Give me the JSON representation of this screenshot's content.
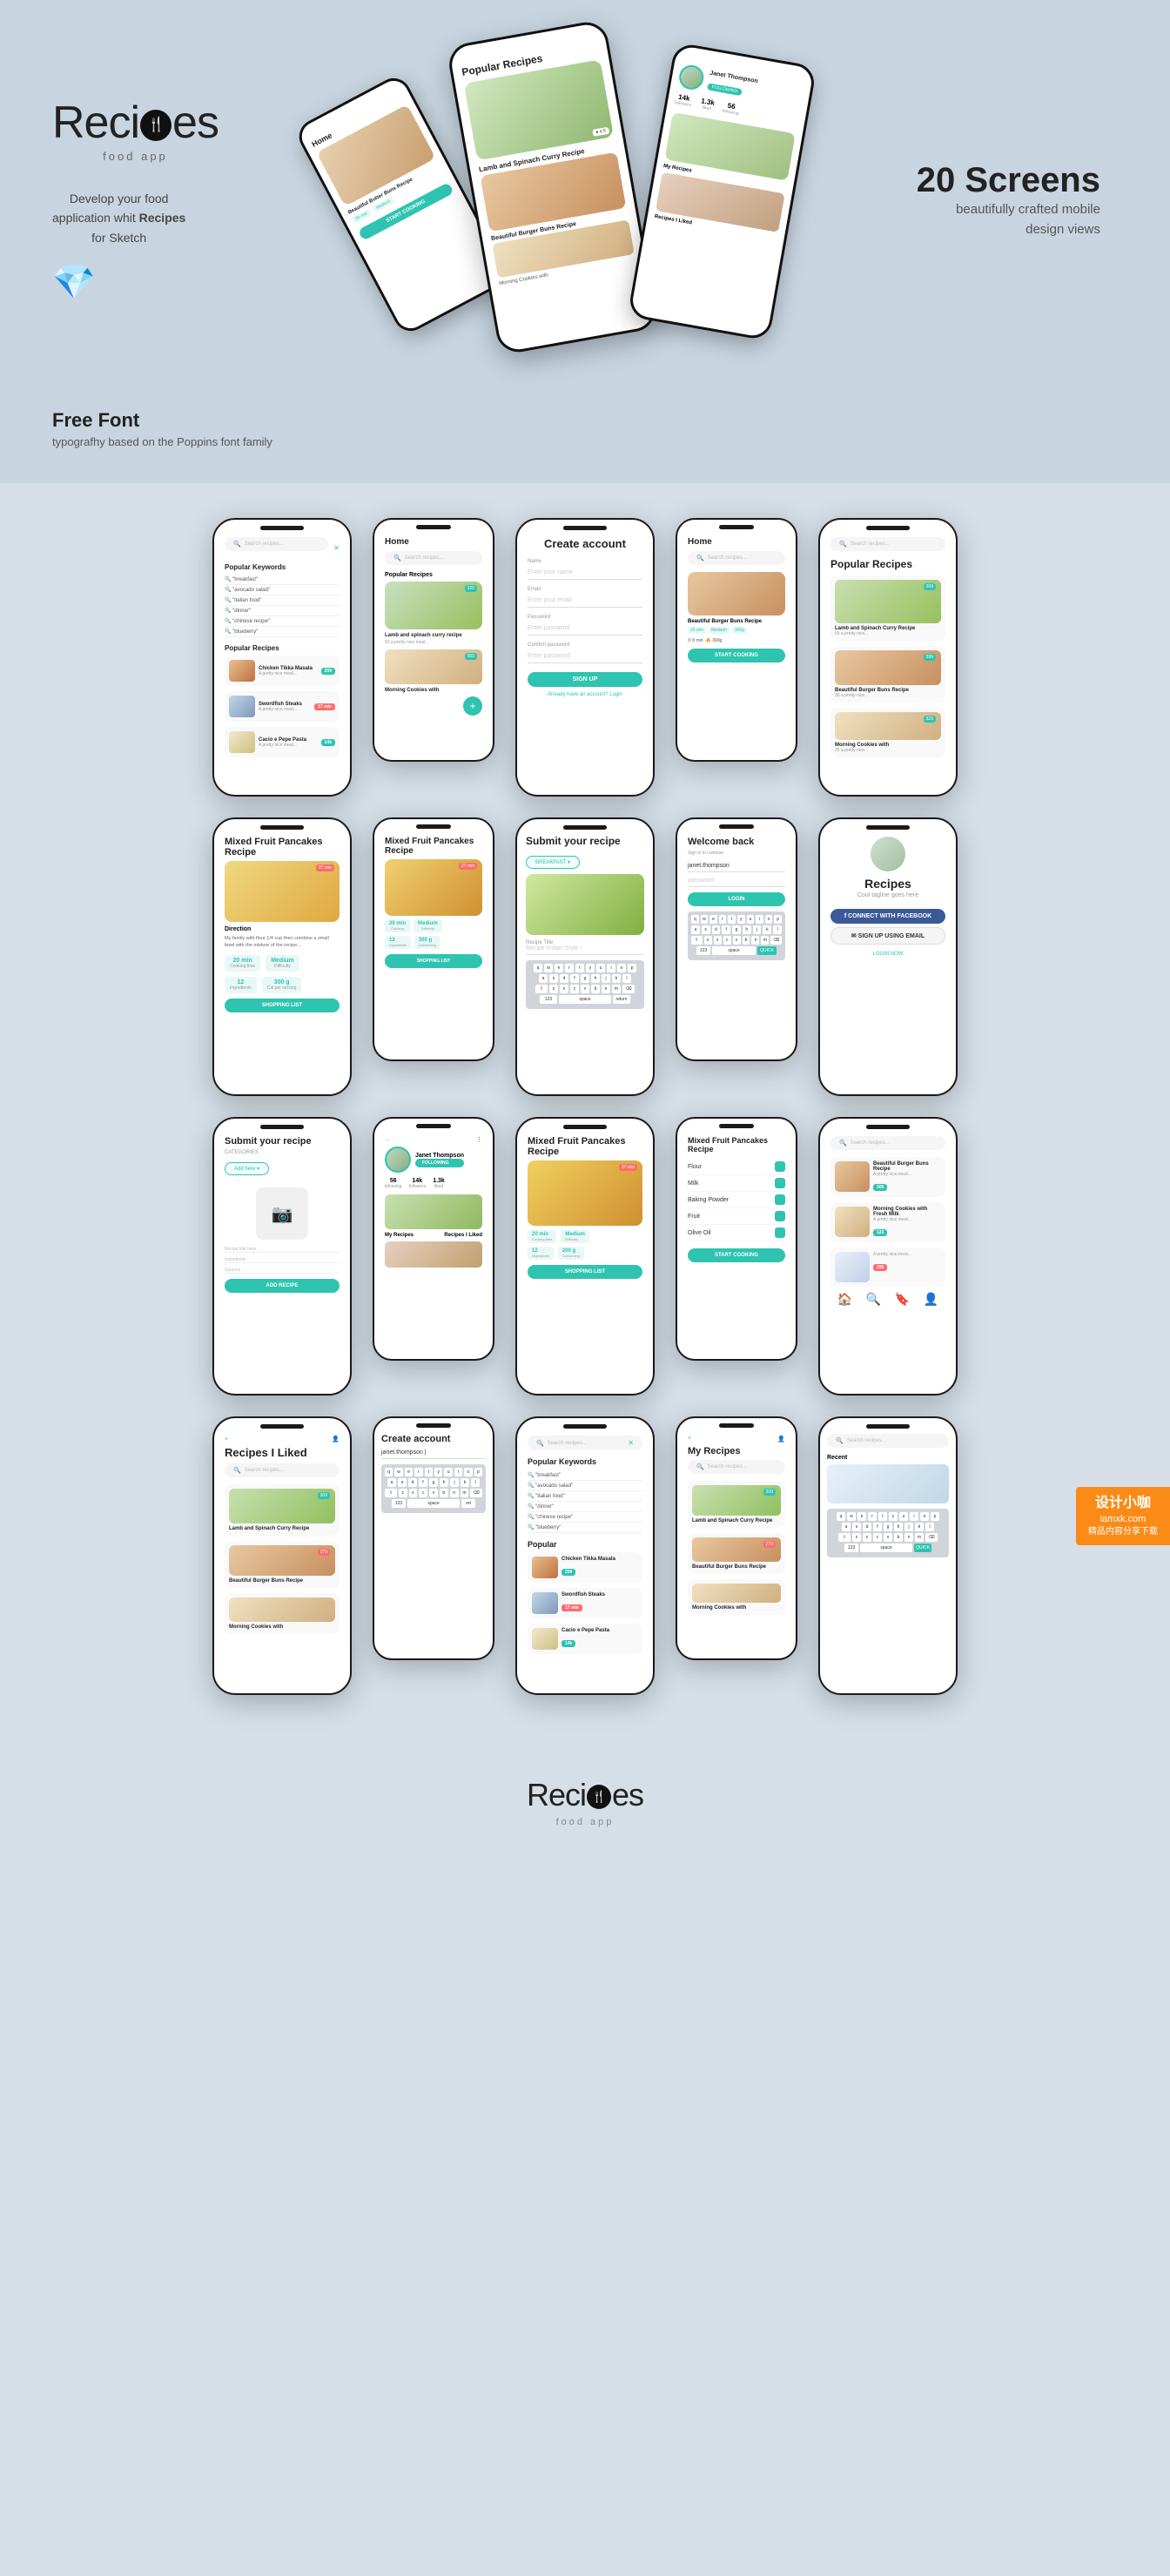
{
  "header": {
    "logo": {
      "text_start": "Reci",
      "text_end": "es",
      "sub": "food app"
    },
    "tagline": "Develop your food application whit Recipes for Sketch",
    "screens": {
      "count": "20 Screens",
      "desc": "beautifully crafted mobile design views"
    },
    "free_font": {
      "title": "Free Font",
      "desc": "typografhy based on the Poppins font family"
    }
  },
  "phones": {
    "row1": [
      {
        "id": "search",
        "title": "Search Recipes",
        "type": "search"
      },
      {
        "id": "home1",
        "title": "Home",
        "type": "home"
      },
      {
        "id": "create_account",
        "title": "Create account",
        "type": "create_account"
      },
      {
        "id": "home2",
        "title": "Home",
        "type": "home2"
      },
      {
        "id": "popular",
        "title": "Popular Recipes",
        "type": "popular"
      }
    ],
    "row2": [
      {
        "id": "recipe_detail",
        "title": "Mixed Fruit Pancakes Recipe",
        "type": "recipe_detail"
      },
      {
        "id": "home3",
        "title": "Home",
        "type": "home3"
      },
      {
        "id": "submit_recipe",
        "title": "Submit your recipe",
        "type": "submit_recipe"
      },
      {
        "id": "welcome_back",
        "title": "Welcome back",
        "type": "welcome_back"
      },
      {
        "id": "recipes",
        "title": "Recipes",
        "type": "recipes_page"
      }
    ],
    "row3": [
      {
        "id": "submit_recipe2",
        "title": "Submit your recipe",
        "type": "submit_recipe2"
      },
      {
        "id": "profile",
        "title": "Janet Thompson",
        "type": "profile"
      },
      {
        "id": "pancake_detail",
        "title": "Mixed Fruit Pancakes Recipe",
        "type": "pancake_detail"
      },
      {
        "id": "shopping",
        "title": "Mixed Fruit Pancakes Recipe",
        "type": "shopping"
      },
      {
        "id": "search2",
        "title": "Search",
        "type": "search2"
      }
    ],
    "row4": [
      {
        "id": "liked",
        "title": "Recipes I Liked",
        "type": "liked"
      },
      {
        "id": "create_account2",
        "title": "Create account",
        "type": "create_account2"
      },
      {
        "id": "popular_keywords",
        "title": "Popular Keywords",
        "type": "popular_keywords"
      },
      {
        "id": "my_recipes",
        "title": "My Recipes",
        "type": "my_recipes"
      },
      {
        "id": "search3",
        "title": "Search",
        "type": "search3"
      }
    ]
  },
  "screens": {
    "search": {
      "placeholder": "Search recipes...",
      "popular_keywords_title": "Popular Keywords",
      "keywords": [
        "breakfast",
        "avocado salad",
        "Italian food",
        "dinner",
        "chinese recipe",
        "blueberry"
      ],
      "popular_recipes_title": "Popular Recipes",
      "recipes": [
        {
          "name": "Chicken Tikka Masala",
          "time": "25 min"
        },
        {
          "name": "Swordfish Steaks",
          "time": "17 min"
        },
        {
          "name": "Cacio e Pepe Pasta",
          "time": "14 min"
        }
      ]
    },
    "create_account": {
      "title": "Create account",
      "name_label": "Name",
      "name_placeholder": "Enter your name",
      "email_label": "Email",
      "email_placeholder": "Enter your email",
      "password_label": "Password",
      "password_placeholder": "Enter password",
      "confirm_label": "Confirm password",
      "confirm_placeholder": "Enter password",
      "btn": "SIGN UP",
      "login_text": "Already have an account? Login"
    },
    "popular": {
      "title": "Popular Recipes",
      "recipes": [
        {
          "name": "Lamb and Spinach Curry Recipe",
          "time": "55 min",
          "tag": "309"
        },
        {
          "name": "Beautiful Burger Buns Recipe",
          "time": "30 min",
          "tag": "399"
        },
        {
          "name": "Morning Cookies with",
          "time": "25 min",
          "tag": "323"
        }
      ]
    },
    "home": {
      "title": "Home",
      "popular_title": "Popular Recipes",
      "recipes": [
        {
          "name": "Lamb and spinach curry recipe"
        },
        {
          "name": "Morning Cookies with"
        }
      ]
    },
    "recipe_detail": {
      "title": "Mixed Fruit Pancakes Recipe",
      "direction": "Direction",
      "time": "20 min",
      "difficulty": "Medium",
      "ingredients": "12",
      "weight": "300g"
    },
    "welcome_back": {
      "title": "Welcome back",
      "username_placeholder": "janet.thompson",
      "password_placeholder": "password",
      "btn": "LOGIN",
      "login_now": "LOGIN NOW"
    },
    "recipes_page": {
      "title": "Recipes",
      "subtitle": "Cool tagline goes here",
      "connect_fb": "CONNECT WITH FACEBOOK",
      "sign_up": "SIGN UP USING EMAIL"
    },
    "profile": {
      "name": "Janet Thompson",
      "stats": {
        "following": "56",
        "followers": "14k",
        "liked": "1.3k"
      },
      "my_recipes": "My Recipes",
      "recipes_liked": "Recipes I Liked"
    },
    "shopping": {
      "title": "Mixed Fruit Pancakes Recipe",
      "ingredients": [
        "Flour",
        "Milk",
        "Baking Powder",
        "Fruit",
        "Olive Oil"
      ],
      "btn": "START COOKING"
    },
    "liked": {
      "title": "Recipes I Liked",
      "recipes": [
        "Lamb and Spinach Curry Recipe",
        "Beautiful Burger Buns Recipe",
        "Morning Cookies with"
      ]
    },
    "my_recipes": {
      "title": "My Recipes",
      "recipes": [
        "Lamb and Spinach Curry Recipe",
        "Beautiful Burger Buns Recipe",
        "Morning Cookies with"
      ]
    }
  },
  "bottom_logo": {
    "text_start": "Reci",
    "text_end": "es",
    "sub": "food app"
  },
  "watermark": {
    "site": "iamxk.com",
    "label": "设计小咖",
    "sub": "精品内容分享下载"
  }
}
